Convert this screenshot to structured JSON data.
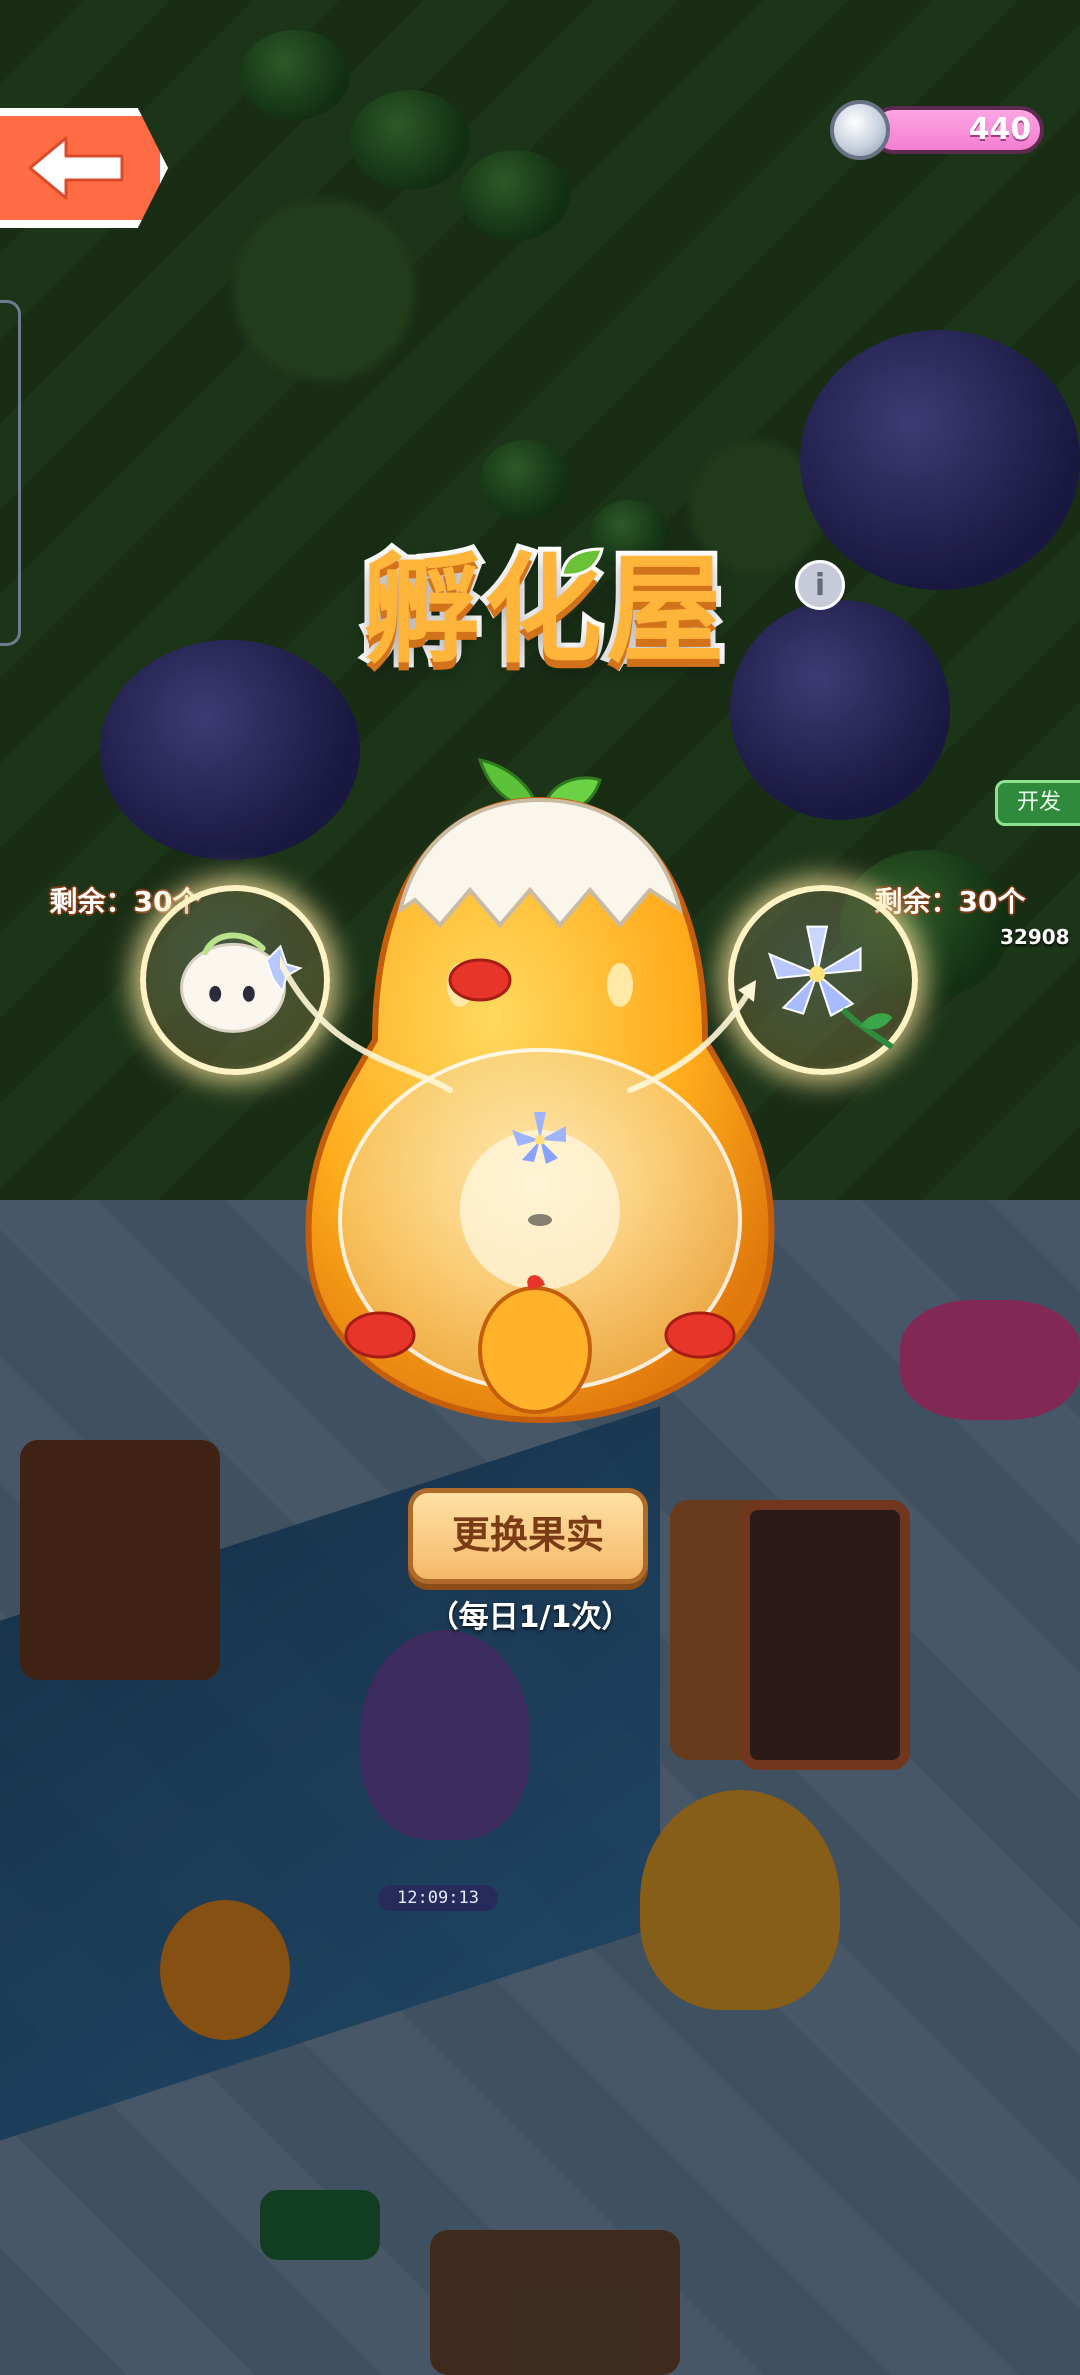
{
  "hud": {
    "back_icon": "back-arrow-icon",
    "coin_icon": "silver-coin-icon",
    "coin_count": "440"
  },
  "title": "孵化屋",
  "info_icon": "info-icon",
  "fruit_left": {
    "remaining": "剩余：30个",
    "icon": "white-fruit-spirit-icon"
  },
  "fruit_right": {
    "remaining": "剩余：30个",
    "icon": "blue-lily-flower-icon"
  },
  "incubator": {
    "icon": "egg-chick-incubator-icon",
    "current_item_icon": "blue-lily-flower-icon"
  },
  "change_button": {
    "label": "更换果实",
    "daily_limit": "（每日1/1次）"
  },
  "world": {
    "timer": "12:09:13",
    "dev_tag": "开发",
    "partial_counter": "32908"
  },
  "colors": {
    "title_orange": "#ffb43a",
    "button_brown": "#7a3b15",
    "coin_pink": "#f27ed1",
    "back_orange": "#ff6b45"
  }
}
